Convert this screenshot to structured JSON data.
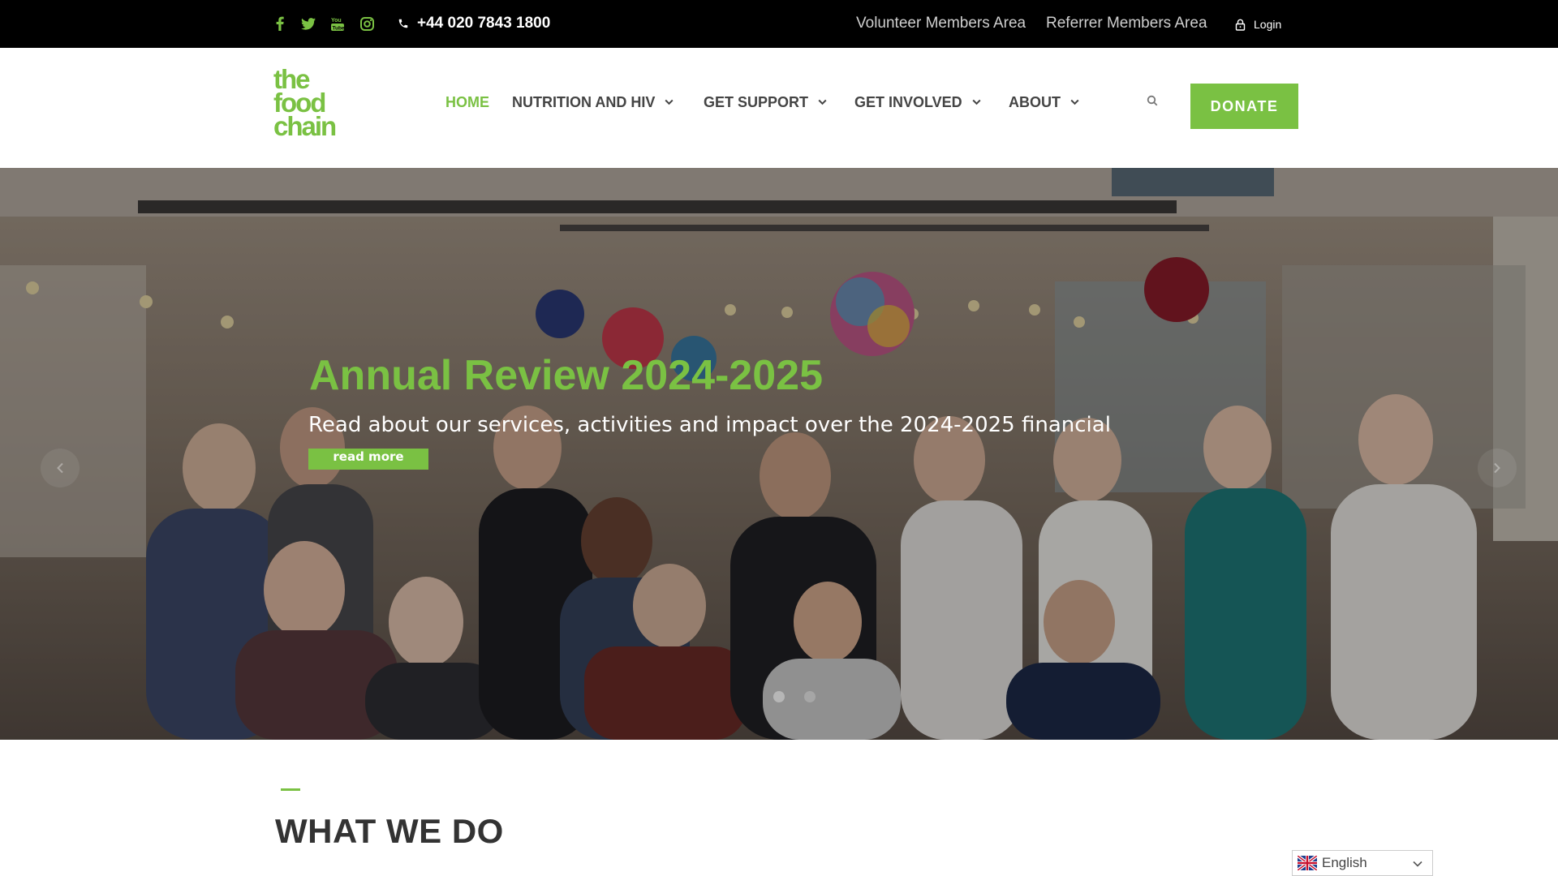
{
  "topbar": {
    "social_icons": [
      "facebook-icon",
      "twitter-icon",
      "youtube-icon",
      "instagram-icon"
    ],
    "phone": "+44 020 7843 1800",
    "links": [
      "Volunteer Members Area",
      "Referrer Members Area"
    ],
    "login_label": "Login"
  },
  "header": {
    "logo_lines": [
      "the",
      "food",
      "chain"
    ],
    "nav": [
      {
        "label": "HOME",
        "active": true,
        "dropdown": false
      },
      {
        "label": "NUTRITION AND HIV",
        "active": false,
        "dropdown": true
      },
      {
        "label": "GET SUPPORT",
        "active": false,
        "dropdown": true
      },
      {
        "label": "GET INVOLVED",
        "active": false,
        "dropdown": true
      },
      {
        "label": "ABOUT",
        "active": false,
        "dropdown": true
      }
    ],
    "donate_label": "DONATE"
  },
  "hero": {
    "title": "Annual Review 2024-2025",
    "subtitle": "Read about our services, activities and impact over the 2024-2025 financial",
    "button_label": "read more",
    "slide_count": 2,
    "active_slide": 1
  },
  "section": {
    "title": "WHAT WE DO"
  },
  "language": {
    "selected": "English"
  },
  "colors": {
    "brand_green": "#7ac143",
    "topbar_bg": "#000000",
    "nav_text": "#444444"
  }
}
